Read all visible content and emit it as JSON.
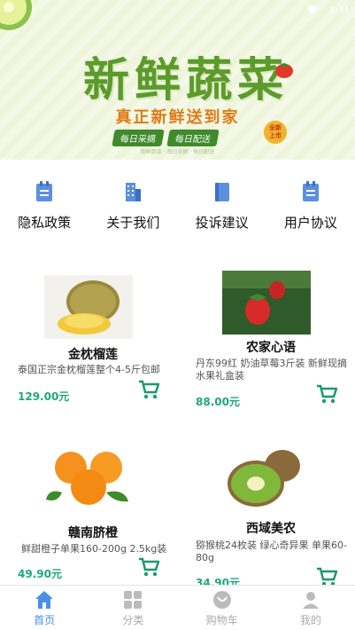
{
  "status": {
    "right_text": "8:31"
  },
  "banner": {
    "title": "新鲜蔬菜",
    "slogan": "真正新鲜送到家",
    "pills": [
      "每日采摘",
      "每日配送"
    ],
    "stamp": "全新\n上市",
    "foot": "新鲜蔬菜 · 每日采摘 · 每日配送"
  },
  "menu": [
    {
      "label": "隐私政策",
      "icon": "document-icon"
    },
    {
      "label": "关于我们",
      "icon": "building-icon"
    },
    {
      "label": "投诉建议",
      "icon": "book-icon"
    },
    {
      "label": "用户协议",
      "icon": "document-icon"
    }
  ],
  "products": [
    {
      "name": "金枕榴莲",
      "desc": "泰国正宗金枕榴莲整个4-5斤包邮",
      "price": "129.00元"
    },
    {
      "name": "农家心语",
      "desc": "丹东99红 奶油草莓3斤装 新鲜现摘水果礼盒装",
      "price": "88.00元"
    },
    {
      "name": "赣南脐橙",
      "desc": "鲜甜橙子单果160-200g 2.5kg装",
      "price": "49.90元"
    },
    {
      "name": "西域美农",
      "desc": "猕猴桃24枚装 绿心奇异果 单果60-80g",
      "price": "34.90元"
    }
  ],
  "tabs": [
    {
      "label": "首页",
      "icon": "home-icon",
      "active": true
    },
    {
      "label": "分类",
      "icon": "grid-icon",
      "active": false
    },
    {
      "label": "购物车",
      "icon": "cart-icon",
      "active": false
    },
    {
      "label": "我的",
      "icon": "user-icon",
      "active": false
    }
  ],
  "colors": {
    "accent": "#4a90e2",
    "price": "#1ea77a",
    "cart": "#1a9a6c",
    "banner_green": "#5c9a2c"
  }
}
